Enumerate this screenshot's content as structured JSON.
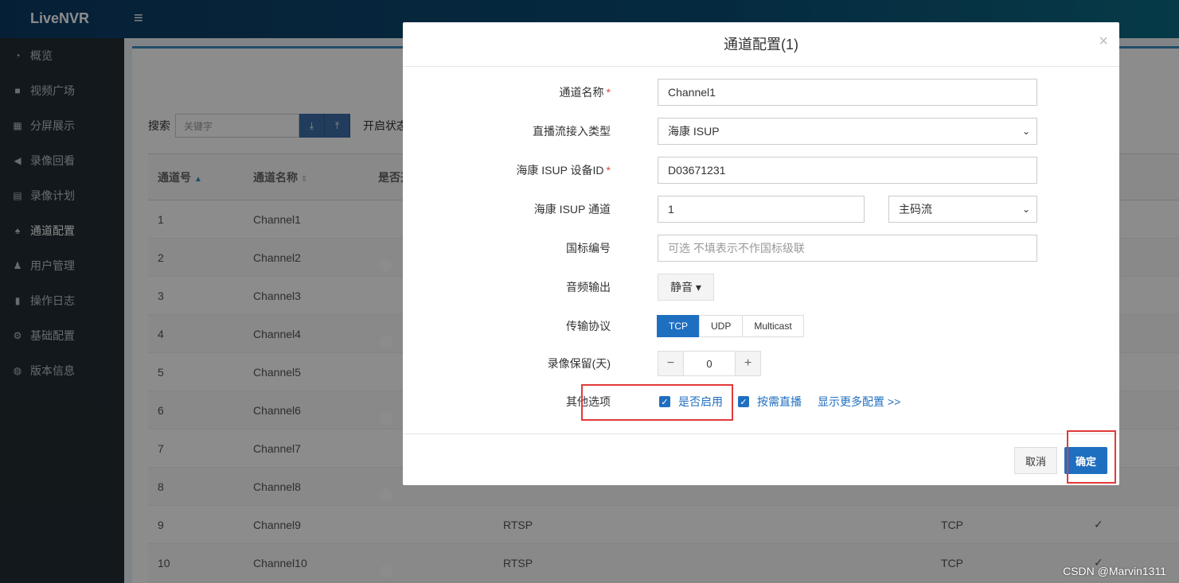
{
  "header": {
    "logo": "LiveNVR",
    "menu_icon": "bars-icon"
  },
  "sidebar": {
    "items": [
      {
        "icon": "dashboard-icon",
        "glyph": "◔",
        "label": "概览"
      },
      {
        "icon": "video-icon",
        "glyph": "■",
        "label": "视频广场"
      },
      {
        "icon": "grid-icon",
        "glyph": "▦",
        "label": "分屏展示"
      },
      {
        "icon": "backward-icon",
        "glyph": "◀",
        "label": "录像回看"
      },
      {
        "icon": "calendar-icon",
        "glyph": "▤",
        "label": "录像计划"
      },
      {
        "icon": "sitemap-icon",
        "glyph": "♠",
        "label": "通道配置"
      },
      {
        "icon": "users-icon",
        "glyph": "♟",
        "label": "用户管理"
      },
      {
        "icon": "file-icon",
        "glyph": "▮",
        "label": "操作日志"
      },
      {
        "icon": "gears-icon",
        "glyph": "⚙",
        "label": "基础配置"
      },
      {
        "icon": "globe-icon",
        "glyph": "◍",
        "label": "版本信息"
      }
    ]
  },
  "toolbar": {
    "search_label": "搜索",
    "search_placeholder": "关键字",
    "filter_label": "开启状态"
  },
  "table": {
    "headers": [
      "通道号",
      "通道名称",
      "是否开"
    ],
    "rows": [
      {
        "id": "1",
        "name": "Channel1",
        "type": "",
        "proto": "",
        "check": ""
      },
      {
        "id": "2",
        "name": "Channel2",
        "type": "",
        "proto": "",
        "check": ""
      },
      {
        "id": "3",
        "name": "Channel3",
        "type": "",
        "proto": "",
        "check": ""
      },
      {
        "id": "4",
        "name": "Channel4",
        "type": "",
        "proto": "",
        "check": ""
      },
      {
        "id": "5",
        "name": "Channel5",
        "type": "",
        "proto": "",
        "check": ""
      },
      {
        "id": "6",
        "name": "Channel6",
        "type": "",
        "proto": "",
        "check": ""
      },
      {
        "id": "7",
        "name": "Channel7",
        "type": "",
        "proto": "",
        "check": ""
      },
      {
        "id": "8",
        "name": "Channel8",
        "type": "",
        "proto": "",
        "check": ""
      },
      {
        "id": "9",
        "name": "Channel9",
        "type": "RTSP",
        "proto": "TCP",
        "check": "✓"
      },
      {
        "id": "10",
        "name": "Channel10",
        "type": "RTSP",
        "proto": "TCP",
        "check": "✓"
      }
    ]
  },
  "modal": {
    "title": "通道配置(1)",
    "close": "×",
    "fields": {
      "channel_name_label": "通道名称",
      "channel_name_value": "Channel1",
      "stream_type_label": "直播流接入类型",
      "stream_type_value": "海康 ISUP",
      "device_id_label": "海康 ISUP 设备ID",
      "device_id_value": "D03671231",
      "isup_channel_label": "海康 ISUP 通道",
      "isup_channel_value": "1",
      "stream_select_value": "主码流",
      "gb_code_label": "国标编号",
      "gb_code_placeholder": "可选 不填表示不作国标级联",
      "audio_label": "音频输出",
      "audio_value": "静音 ▾",
      "transport_label": "传输协议",
      "transport_options": [
        "TCP",
        "UDP",
        "Multicast"
      ],
      "transport_selected": "TCP",
      "record_label": "录像保留(天)",
      "record_value": "0",
      "options_label": "其他选项",
      "enable_label": "是否启用",
      "ondemand_label": "按需直播",
      "more_link": "显示更多配置 >>"
    },
    "cancel_label": "取消",
    "ok_label": "确定"
  },
  "watermark": "CSDN @Marvin1311"
}
